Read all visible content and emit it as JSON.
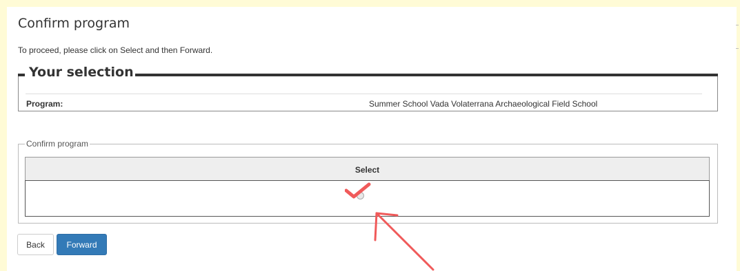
{
  "page": {
    "title": "Confirm program",
    "instruction": "To proceed, please click on Select and then Forward."
  },
  "selection": {
    "legend": "Your selection",
    "program_label": "Program:",
    "program_value": "Summer School Vada Volaterrana Archaeological Field School"
  },
  "confirm": {
    "legend": "Confirm program",
    "column_header": "Select",
    "radio_selected": false
  },
  "buttons": {
    "back": "Back",
    "forward": "Forward"
  },
  "annotations": {
    "checkmark_color": "#f05a5a",
    "arrow_color": "#f05a5a"
  },
  "colors": {
    "page_bg": "#fffbd6",
    "primary_button": "#337ab7"
  }
}
